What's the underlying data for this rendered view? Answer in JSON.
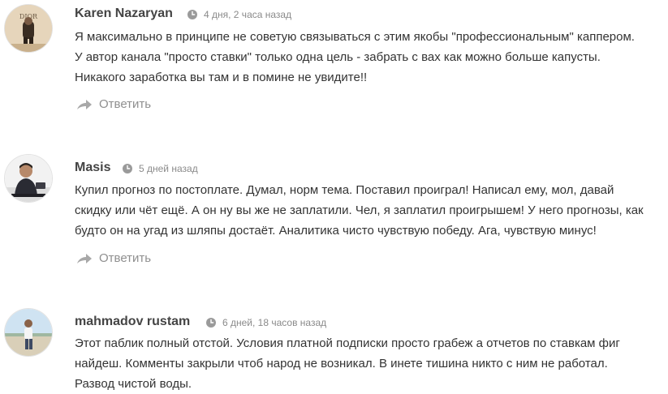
{
  "comments": [
    {
      "author": "Karen Nazaryan",
      "time": "4 дня, 2 часа назад",
      "avatar_icon": "avatar-photo-icon",
      "lines": [
        "Я максимально в принципе не советую связываться с этим якобы \"профессиональным\" каппером.",
        "У автор канала \"просто ставки\" только одна цель - забрать с вах как можно больше капусты.",
        "Никакого заработка вы там и в помине не увидите!!"
      ],
      "reply_label": "Ответить"
    },
    {
      "author": "Masis",
      "time": "5 дней назад",
      "avatar_icon": "avatar-photo-icon",
      "lines": [
        "Купил прогноз по постоплате. Думал, норм тема. Поставил проиграл! Написал ему, мол, давай",
        "скидку или чёт ещё. А он ну вы же не заплатили. Чел, я заплатил проигрышем! У него прогнозы, как",
        "будто он на угад из шляпы достаёт. Аналитика чисто чувствую победу. Ага, чувствую минус!"
      ],
      "reply_label": "Ответить"
    },
    {
      "author": "mahmadov rustam",
      "time": "6 дней, 18 часов назад",
      "avatar_icon": "avatar-photo-icon",
      "lines": [
        "Этот паблик полный отстой. Условия платной подписки просто грабеж а отчетов по ставкам фиг",
        "найдеш. Комменты закрыли чтоб народ не возникал. В инете тишина никто с ним не работал.",
        "Развод чистой воды."
      ]
    }
  ],
  "colors": {
    "text": "#333333",
    "author": "#444444",
    "meta": "#8a8a8a",
    "reply": "#8f8f8f"
  }
}
